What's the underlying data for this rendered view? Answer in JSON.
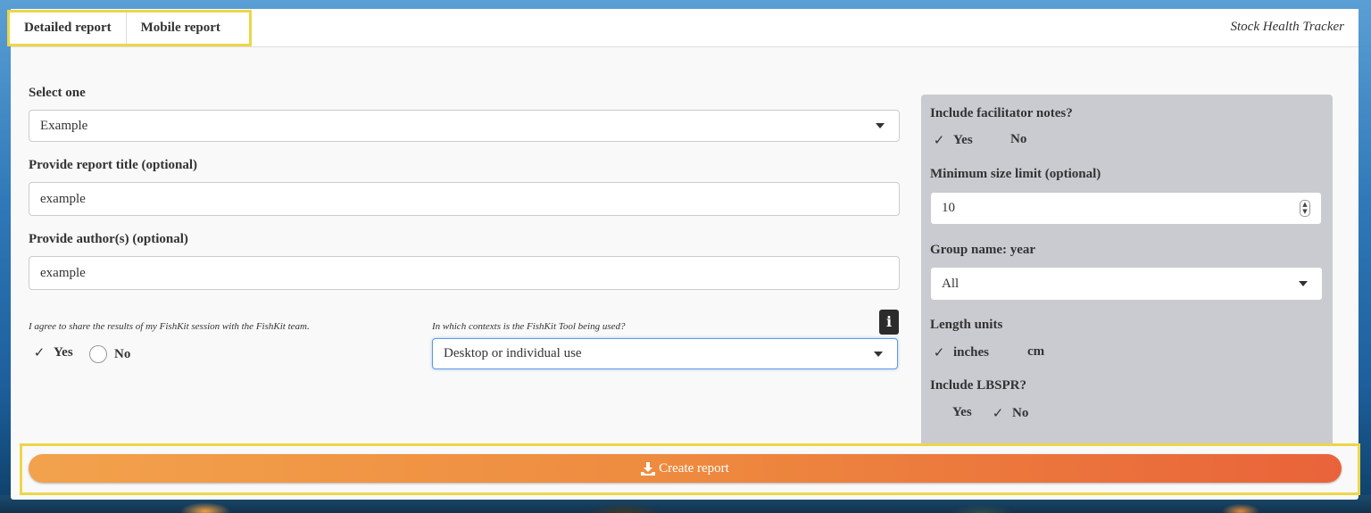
{
  "tabs": [
    {
      "label": "Detailed report",
      "active": true
    },
    {
      "label": "Mobile report",
      "active": false
    }
  ],
  "brand": "Stock Health Tracker",
  "form": {
    "select_one": {
      "label": "Select one",
      "value": "Example"
    },
    "title": {
      "label": "Provide report title (optional)",
      "value": "example"
    },
    "authors": {
      "label": "Provide author(s) (optional)",
      "value": "example"
    },
    "agree": {
      "label": "I agree to share the results of my FishKit session with the FishKit team.",
      "yes": "Yes",
      "no": "No",
      "selected": "Yes"
    },
    "contexts": {
      "label": "In which contexts is the FishKit Tool being used?",
      "value": "Desktop or individual use",
      "info_icon": "i"
    }
  },
  "sidebar": {
    "facilitator": {
      "label": "Include facilitator notes?",
      "yes": "Yes",
      "no": "No",
      "selected": "Yes"
    },
    "min_size": {
      "label": "Minimum size limit (optional)",
      "value": "10"
    },
    "group": {
      "label": "Group name: year",
      "value": "All"
    },
    "units": {
      "label": "Length units",
      "opt1": "inches",
      "opt2": "cm",
      "selected": "inches"
    },
    "lbspr": {
      "label": "Include LBSPR?",
      "yes": "Yes",
      "no": "No",
      "selected": "No"
    }
  },
  "create_button": {
    "label": "Create report",
    "icon": "download-icon"
  },
  "colors": {
    "highlight": "#ecd648",
    "button_start": "#f2a24c",
    "button_end": "#e9633a",
    "sidebar_bg": "#c9cbd1"
  }
}
